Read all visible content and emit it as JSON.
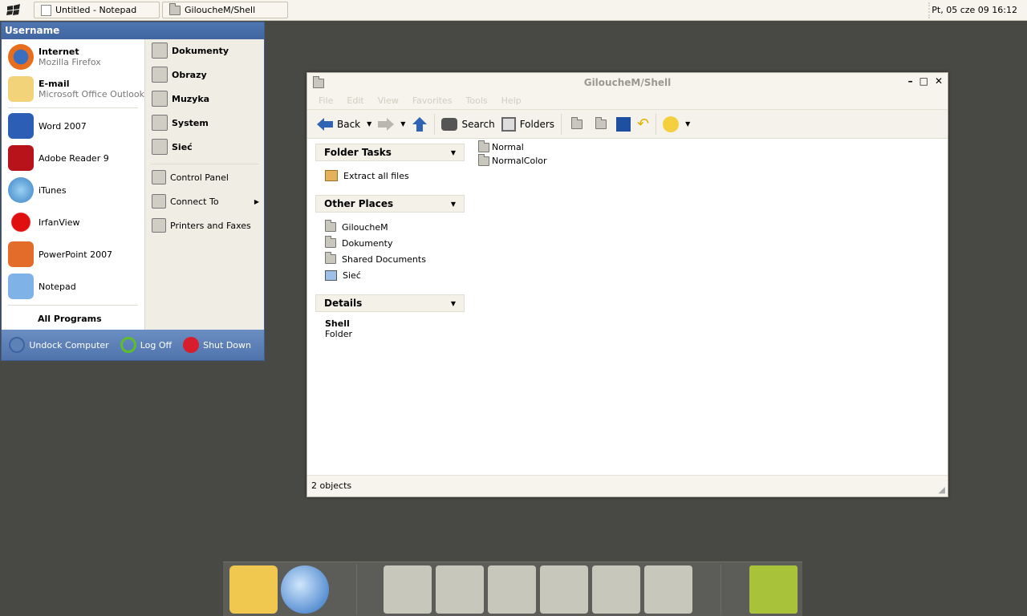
{
  "taskbar": {
    "buttons": [
      {
        "label": "Untitled - Notepad",
        "icon": "notepad-icon"
      },
      {
        "label": "GiloucheM/Shell",
        "icon": "folder-icon"
      }
    ],
    "clock": "Pt, 05 cze 09 16:12"
  },
  "start_menu": {
    "username": "Username",
    "pinned": [
      {
        "title": "Internet",
        "subtitle": "Mozilla Firefox"
      },
      {
        "title": "E-mail",
        "subtitle": "Microsoft Office Outlook"
      }
    ],
    "programs": [
      "Word 2007",
      "Adobe Reader 9",
      "iTunes",
      "IrfanView",
      "PowerPoint 2007",
      "Notepad"
    ],
    "all_programs": "All Programs",
    "places": [
      "Dokumenty",
      "Obrazy",
      "Muzyka",
      "System",
      "Sieć"
    ],
    "system_items": [
      "Control Panel",
      "Connect To",
      "Printers and Faxes"
    ],
    "footer": [
      "Undock Computer",
      "Log Off",
      "Shut Down"
    ]
  },
  "explorer": {
    "title": "GiloucheM/Shell",
    "menu": [
      "File",
      "Edit",
      "View",
      "Favorites",
      "Tools",
      "Help"
    ],
    "toolbar": {
      "back": "Back",
      "search": "Search",
      "folders": "Folders"
    },
    "panels": [
      {
        "title": "Folder Tasks",
        "items": [
          "Extract all files"
        ]
      },
      {
        "title": "Other Places",
        "items": [
          "GiloucheM",
          "Dokumenty",
          "Shared Documents",
          "Sieć"
        ]
      }
    ],
    "details": {
      "title": "Details",
      "name": "Shell",
      "type": "Folder"
    },
    "files": [
      "Normal",
      "NormalColor"
    ],
    "status": "2 objects"
  },
  "colors": {
    "accent": "#4f74ac",
    "desktop": "#484844"
  }
}
